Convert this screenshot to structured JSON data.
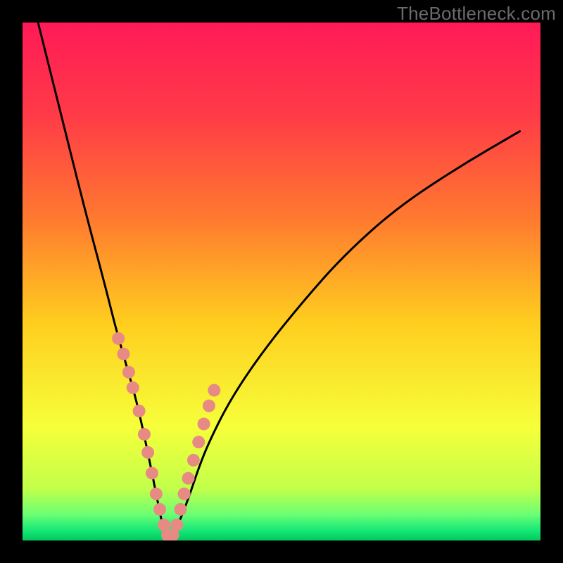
{
  "watermark": "TheBottleneck.com",
  "chart_data": {
    "type": "line",
    "title": "",
    "xlabel": "",
    "ylabel": "",
    "xlim": [
      0,
      100
    ],
    "ylim": [
      0,
      100
    ],
    "grid": false,
    "notes": "Bottleneck V-curve over rainbow gradient. X = relative hardware balance (percent), Y = bottleneck percentage (higher = worse). Minimum near x≈28. No axis ticks or labels visible.",
    "series": [
      {
        "name": "bottleneck-curve",
        "x": [
          3,
          8,
          12,
          16,
          18,
          20,
          22,
          24,
          26,
          27,
          28,
          29,
          30,
          32,
          34,
          36,
          40,
          46,
          54,
          62,
          72,
          84,
          96
        ],
        "y": [
          100,
          80,
          64,
          49,
          41,
          34,
          27,
          18,
          8,
          3,
          0.5,
          0.5,
          3,
          8,
          14,
          19,
          27,
          36,
          46,
          55,
          64,
          72,
          79
        ]
      }
    ],
    "highlight_points": {
      "name": "selected-range-dots",
      "x": [
        18.5,
        19.5,
        20.5,
        21.3,
        22.5,
        23.5,
        24.2,
        25,
        25.8,
        26.5,
        27.3,
        28,
        29,
        29.8,
        30.5,
        31.2,
        32,
        33,
        34,
        35,
        36,
        37
      ],
      "y": [
        39,
        36,
        32.5,
        29.5,
        25,
        20.5,
        17,
        13,
        9,
        6,
        3,
        1,
        1,
        3,
        6,
        9,
        12,
        15.5,
        19,
        22.5,
        26,
        29
      ]
    },
    "gradient_stops": [
      {
        "pct": 0,
        "color": "#ff1a57"
      },
      {
        "pct": 18,
        "color": "#ff3b47"
      },
      {
        "pct": 38,
        "color": "#ff7a2f"
      },
      {
        "pct": 58,
        "color": "#ffce1f"
      },
      {
        "pct": 78,
        "color": "#f6ff3a"
      },
      {
        "pct": 90,
        "color": "#c2ff4a"
      },
      {
        "pct": 95,
        "color": "#6bff74"
      },
      {
        "pct": 98,
        "color": "#17e877"
      },
      {
        "pct": 100,
        "color": "#03c95e"
      }
    ]
  }
}
